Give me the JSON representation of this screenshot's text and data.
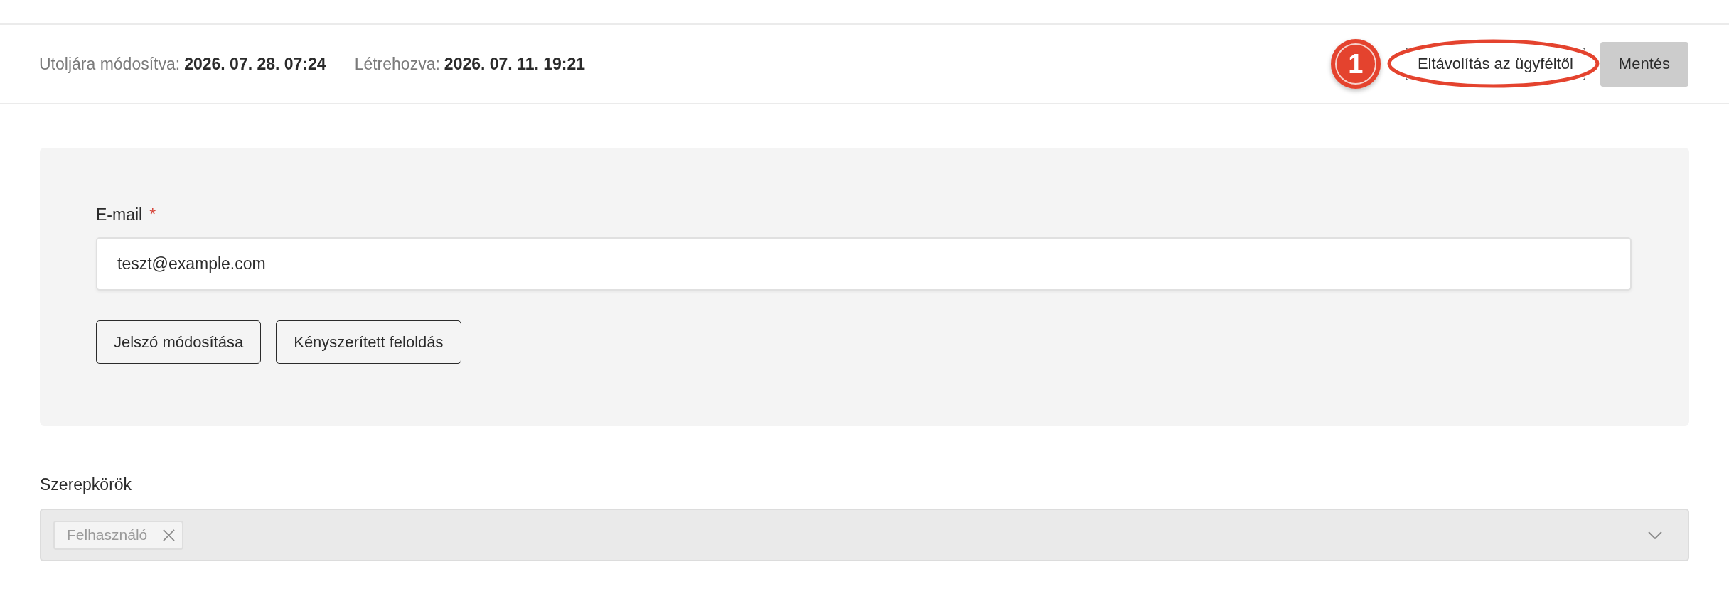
{
  "header": {
    "meta": [
      {
        "label": "Utoljára módosítva:",
        "value": "2026. 07. 28. 07:24"
      },
      {
        "label": "Létrehozva:",
        "value": "2026. 07. 11. 19:21"
      }
    ],
    "annotation": {
      "number": "1"
    },
    "actions": [
      {
        "kind": "outline",
        "label": "Eltávolítás az ügyféltől",
        "highlighted": true
      },
      {
        "kind": "filled",
        "label": "Mentés",
        "highlighted": false
      }
    ]
  },
  "account_panel": {
    "email": {
      "label": "E-mail",
      "required_mark": "*",
      "value": "teszt@example.com"
    },
    "buttons": [
      "Jelszó módosítása",
      "Kényszerített feloldás"
    ]
  },
  "roles": {
    "label": "Szerepkörök",
    "disabled": true,
    "tags": [
      {
        "label": "Felhasználó"
      }
    ]
  }
}
